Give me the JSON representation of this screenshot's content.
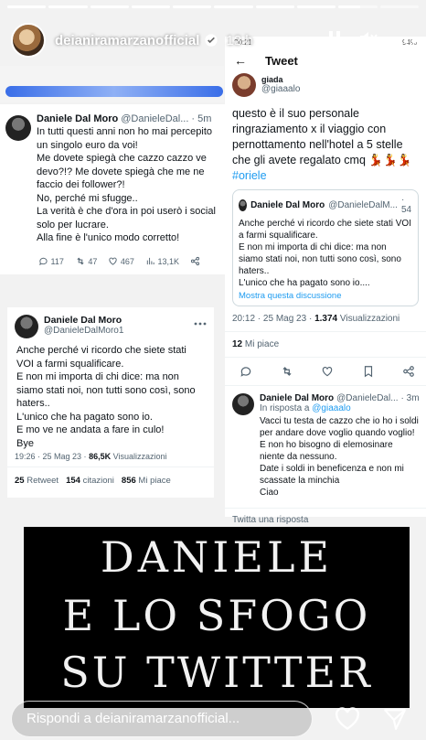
{
  "story": {
    "progress": [
      1,
      1,
      1,
      1,
      1,
      1,
      1,
      1,
      0.55,
      0
    ],
    "username": "deianiramarzanofficial",
    "time": "12 h",
    "reply_placeholder": "Rispondi a deianiramarzanofficial..."
  },
  "tweet_left": {
    "name": "Daniele Dal Moro",
    "handle": "@DanieleDal...",
    "time": "· 5m",
    "text": "In tutti questi anni non ho mai percepito un singolo euro da voi!\nMe dovete spiegà che cazzo cazzo ve devo?!? Me dovete spiegà che me ne faccio dei follower?!\nNo, perché mi sfugge..\nLa verità è che d'ora in poi userò i social solo per lucrare.\nAlla fine è l'unico modo corretto!",
    "replies": "117",
    "retweets": "47",
    "likes": "467",
    "views": "13,1K"
  },
  "tweet_mid": {
    "name": "Daniele Dal Moro",
    "handle": "@DanieleDalMoro1",
    "text": "Anche perché vi ricordo che siete stati VOI a farmi squalificare.\nE non mi importa di chi dice: ma non siamo stati noi, non tutti sono così, sono haters..\nL'unico che ha pagato sono io.\nE mo ve ne andata a fare in culo!\nBye",
    "meta": "19:26 · 25 Mag 23 ·",
    "views": "86,5K",
    "views_label": "Visualizzazioni",
    "retweets": "25",
    "retweets_label": "Retweet",
    "quotes": "154",
    "quotes_label": "citazioni",
    "likes": "856",
    "likes_label": "Mi piace"
  },
  "tweet_right": {
    "status_time": "20:21",
    "battery": "94%",
    "header_title": "Tweet",
    "top_name": "giada",
    "top_handle": "@giaaalo",
    "top_text": "questo è il suo personale ringraziamento x il viaggio con pernottamento nell'hotel a 5 stelle che gli avete regalato cmq",
    "top_tag": "#oriele",
    "quoted_name": "Daniele Dal Moro",
    "quoted_handle": "@DanieleDalM...",
    "quoted_time": "· 54",
    "quoted_text": "Anche perché vi ricordo che siete stati VOI a farmi squalificare.\nE non mi importa di chi dice: ma non siamo stati noi, non tutti sono così, sono haters..\nL'unico che ha pagato sono io....",
    "show_thread": "Mostra questa discussione",
    "meta": "20:12 · 25 Mag 23 ·",
    "views": "1.374",
    "views_label": "Visualizzazioni",
    "likes": "12",
    "likes_label": "Mi piace",
    "reply_name": "Daniele Dal Moro",
    "reply_handle": "@DanieleDal...",
    "reply_time": "· 3m",
    "reply_in": "In risposta a",
    "reply_to": "@giaaalo",
    "reply_text": "Vacci tu testa de cazzo che io ho i soldi per andare dove voglio quando voglio!\nE non ho bisogno di elemosinare niente da nessuno.\nDate i soldi in beneficenza e non mi scassate la minchia\nCiao",
    "compose_placeholder": "Twitta una risposta"
  },
  "banner": {
    "line1": "DANIELE",
    "line2": "E LO SFOGO",
    "line3": "SU TWITTER"
  },
  "colors": {
    "twitter_blue": "#1d9bf0",
    "banner_bg": "#000000",
    "banner_text": "#f2f2f2"
  }
}
